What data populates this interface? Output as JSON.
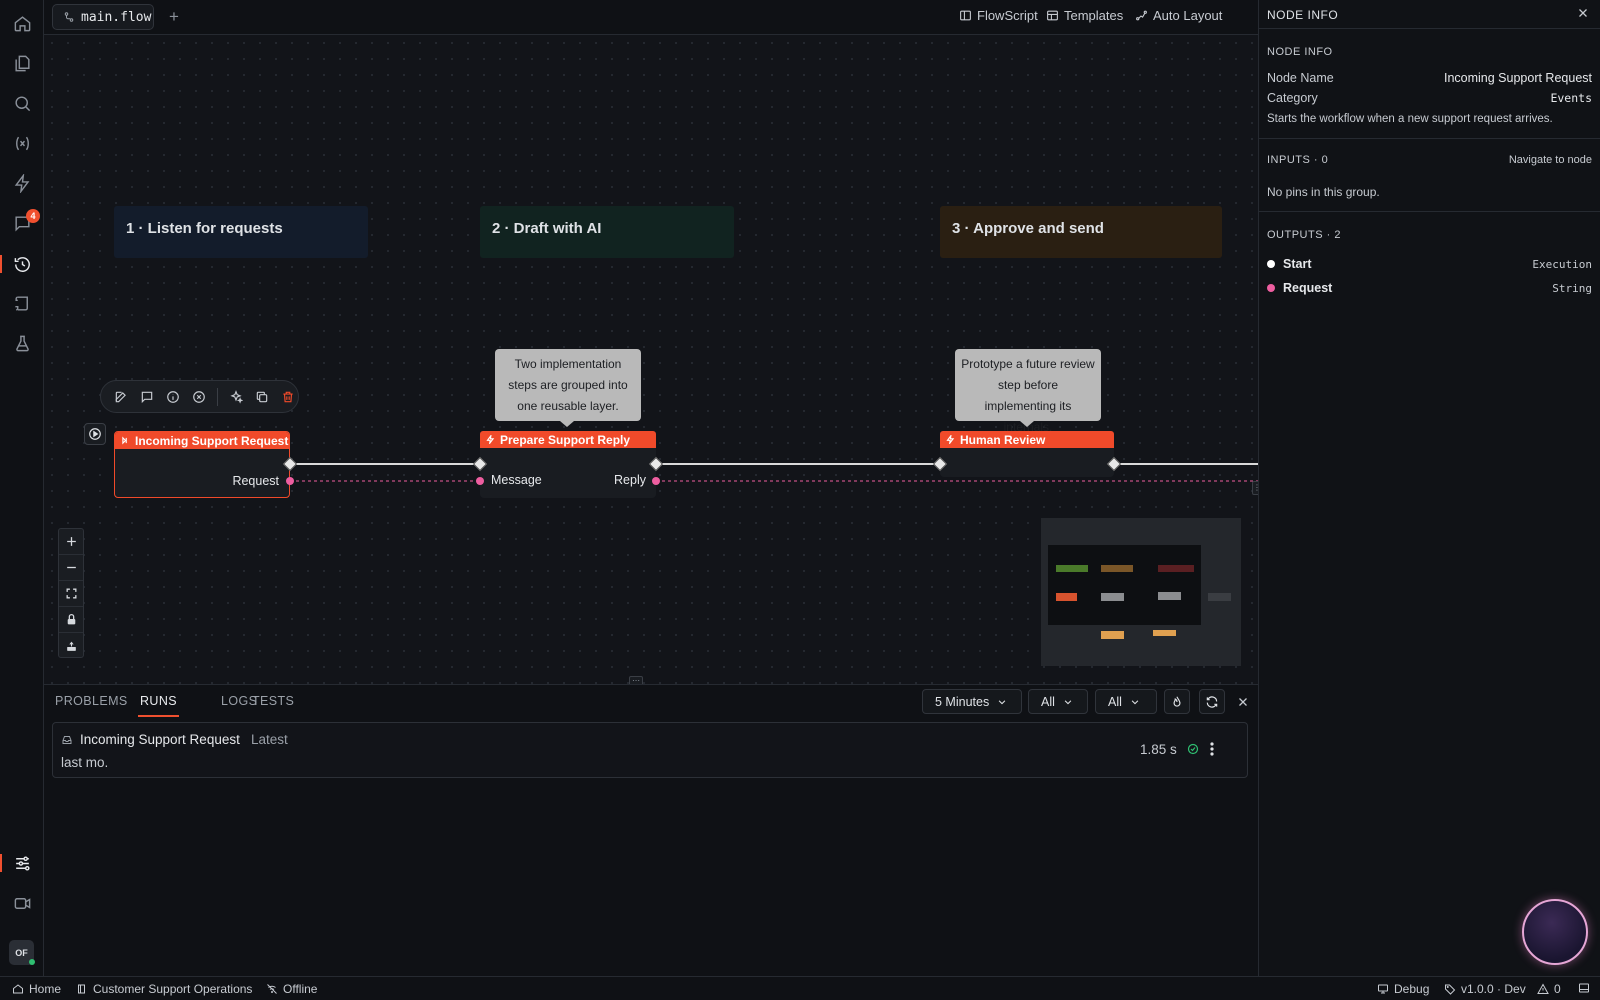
{
  "activity": {
    "notifications_count": "4",
    "avatar": "OF"
  },
  "topbar": {
    "file_tab": "main.flow",
    "new_tab": "+",
    "flowscript": "FlowScript",
    "templates": "Templates",
    "auto_layout": "Auto Layout"
  },
  "canvas": {
    "groups": [
      {
        "title": "1 · Listen for requests",
        "color": "#131c2b"
      },
      {
        "title": "2 · Draft with AI",
        "color": "#112320"
      },
      {
        "title": "3 · Approve and send",
        "color": "#2a1f12"
      }
    ],
    "nodes": [
      {
        "title": "Incoming Support Request",
        "output_pin": "Request"
      },
      {
        "title": "Prepare Support Reply",
        "input_pin": "Message",
        "output_pin": "Reply"
      },
      {
        "title": "Human Review"
      }
    ],
    "comments": [
      "Two implementation steps are grouped into one reusable layer.",
      "Prototype a future review step before implementing its internals."
    ],
    "accent_color": "#f04a2a",
    "pin_color": "#ee5ea0"
  },
  "bottom": {
    "tabs": [
      "PROBLEMS",
      "RUNS",
      "LOGS",
      "TESTS"
    ],
    "active_tab": "RUNS",
    "time_range": "5 Minutes",
    "filter_1": "All",
    "filter_2": "All",
    "run": {
      "name": "Incoming Support Request",
      "tag": "Latest",
      "when": "last mo.",
      "duration": "1.85 s",
      "status_color": "#2fbf71"
    }
  },
  "panel": {
    "title": "NODE INFO",
    "section": "NODE INFO",
    "node_name_label": "Node Name",
    "node_name": "Incoming Support Request",
    "category_label": "Category",
    "category": "Events",
    "description": "Starts the workflow when a new support request arrives.",
    "inputs_header": "INPUTS · 0",
    "navigate": "Navigate to node",
    "no_pins": "No pins in this group.",
    "outputs_header": "OUTPUTS · 2",
    "outputs": [
      {
        "name": "Start",
        "type": "Execution",
        "color": "#ffffff"
      },
      {
        "name": "Request",
        "type": "String",
        "color": "#ee5ea0"
      }
    ]
  },
  "status": {
    "home": "Home",
    "project": "Customer Support Operations",
    "network": "Offline",
    "debug": "Debug",
    "version": "v1.0.0 · Dev",
    "warnings": "0"
  }
}
